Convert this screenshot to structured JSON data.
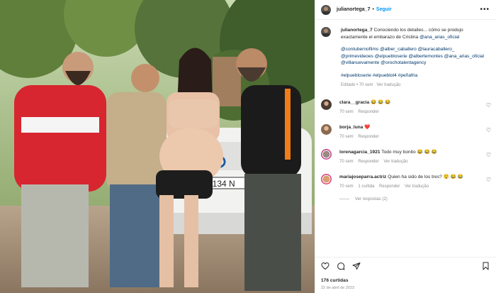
{
  "post": {
    "username": "julianortega_7",
    "follow_label": "Seguir",
    "more_label": "•••",
    "caption_text": "Conociendo los detalles... cómo se produjo exactamente el embarazo de Cristina ",
    "caption_mention": "@ana_arias_oficial",
    "caption_tags_1": "@contubernofilms @alber_caballero @lauracaballero_ @primevideoes @elpuebloserie @albertemontes @ana_arias_oficial @villanuevamente @orochotalentagency",
    "caption_tags_2": "#elpuebloserie #elpueblot4 #peñafria",
    "caption_edited": "Editado",
    "caption_age": "70 sem",
    "caption_translate": "Ver tradução"
  },
  "comments": [
    {
      "user": "clara__gracia",
      "text": "😂 😂 😂",
      "age": "70 sem",
      "reply": "Responder",
      "likes": "",
      "translate": ""
    },
    {
      "user": "borja_luna",
      "text": "❤️",
      "age": "70 sem",
      "reply": "Responder",
      "likes": "",
      "translate": ""
    },
    {
      "user": "lorenagarcia_1921",
      "text": "Todo muy bonito 😂 😂 😂",
      "age": "70 sem",
      "reply": "Responder",
      "likes": "",
      "translate": "Ver tradução"
    },
    {
      "user": "mariajoseparra.actriz",
      "text": "Quien ha sido de los tres? 😲 😂 😂",
      "age": "70 sem",
      "reply": "Responder",
      "likes": "1 curtida",
      "translate": "Ver tradução"
    }
  ],
  "view_replies": "Ver respostas (2)",
  "footer": {
    "likes": "176 curtidas",
    "date": "22 de abril de 2023"
  },
  "icons": {
    "like": "heart-icon",
    "comment": "comment-icon",
    "share": "share-icon",
    "save": "bookmark-icon"
  },
  "colors": {
    "follow": "#0095f6",
    "link": "#00376b",
    "muted": "#8e8e8e"
  },
  "photo": {
    "plate_text": "4134 N"
  }
}
